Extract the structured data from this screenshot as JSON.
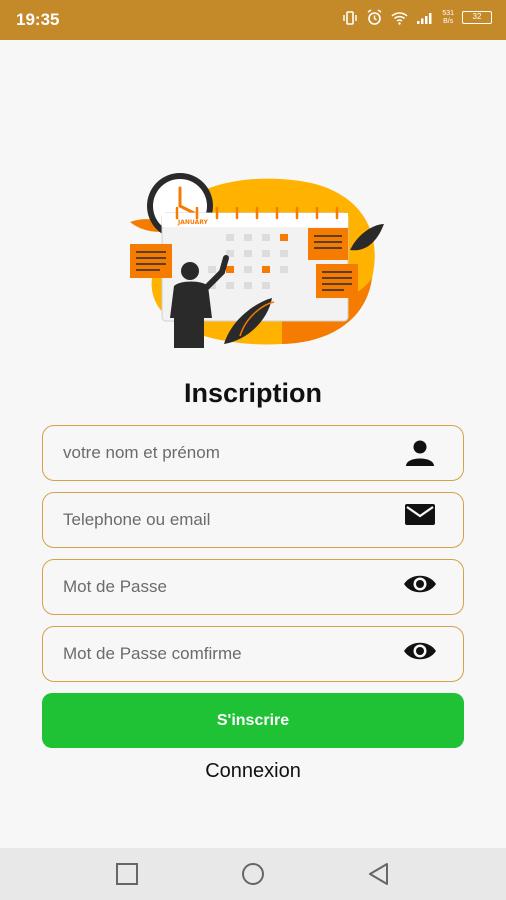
{
  "status_bar": {
    "time": "19:35",
    "net_speed_top": "531",
    "net_speed_bottom": "B/s",
    "battery_level": "32",
    "icons": [
      "vibrate-icon",
      "alarm-icon",
      "wifi-icon",
      "signal-icon",
      "battery-icon"
    ]
  },
  "illustration": {
    "calendar_month": "JANUARY",
    "accent_color": "#f57c00",
    "blob_color": "#ffb300"
  },
  "form": {
    "title": "Inscription",
    "fields": [
      {
        "placeholder": "votre nom et prénom",
        "icon": "person-icon"
      },
      {
        "placeholder": "Telephone ou email",
        "icon": "mail-icon"
      },
      {
        "placeholder": "Mot de Passe",
        "icon": "eye-icon"
      },
      {
        "placeholder": "Mot de Passe comfirme",
        "icon": "eye-icon"
      }
    ],
    "submit_label": "S'inscrire",
    "login_link": "Connexion"
  },
  "nav_bar": {
    "buttons": [
      "recent-apps-icon",
      "home-icon",
      "back-icon"
    ]
  },
  "colors": {
    "status_bar": "#c48a2a",
    "field_border": "#d4a24c",
    "submit_button": "#1fc135"
  }
}
